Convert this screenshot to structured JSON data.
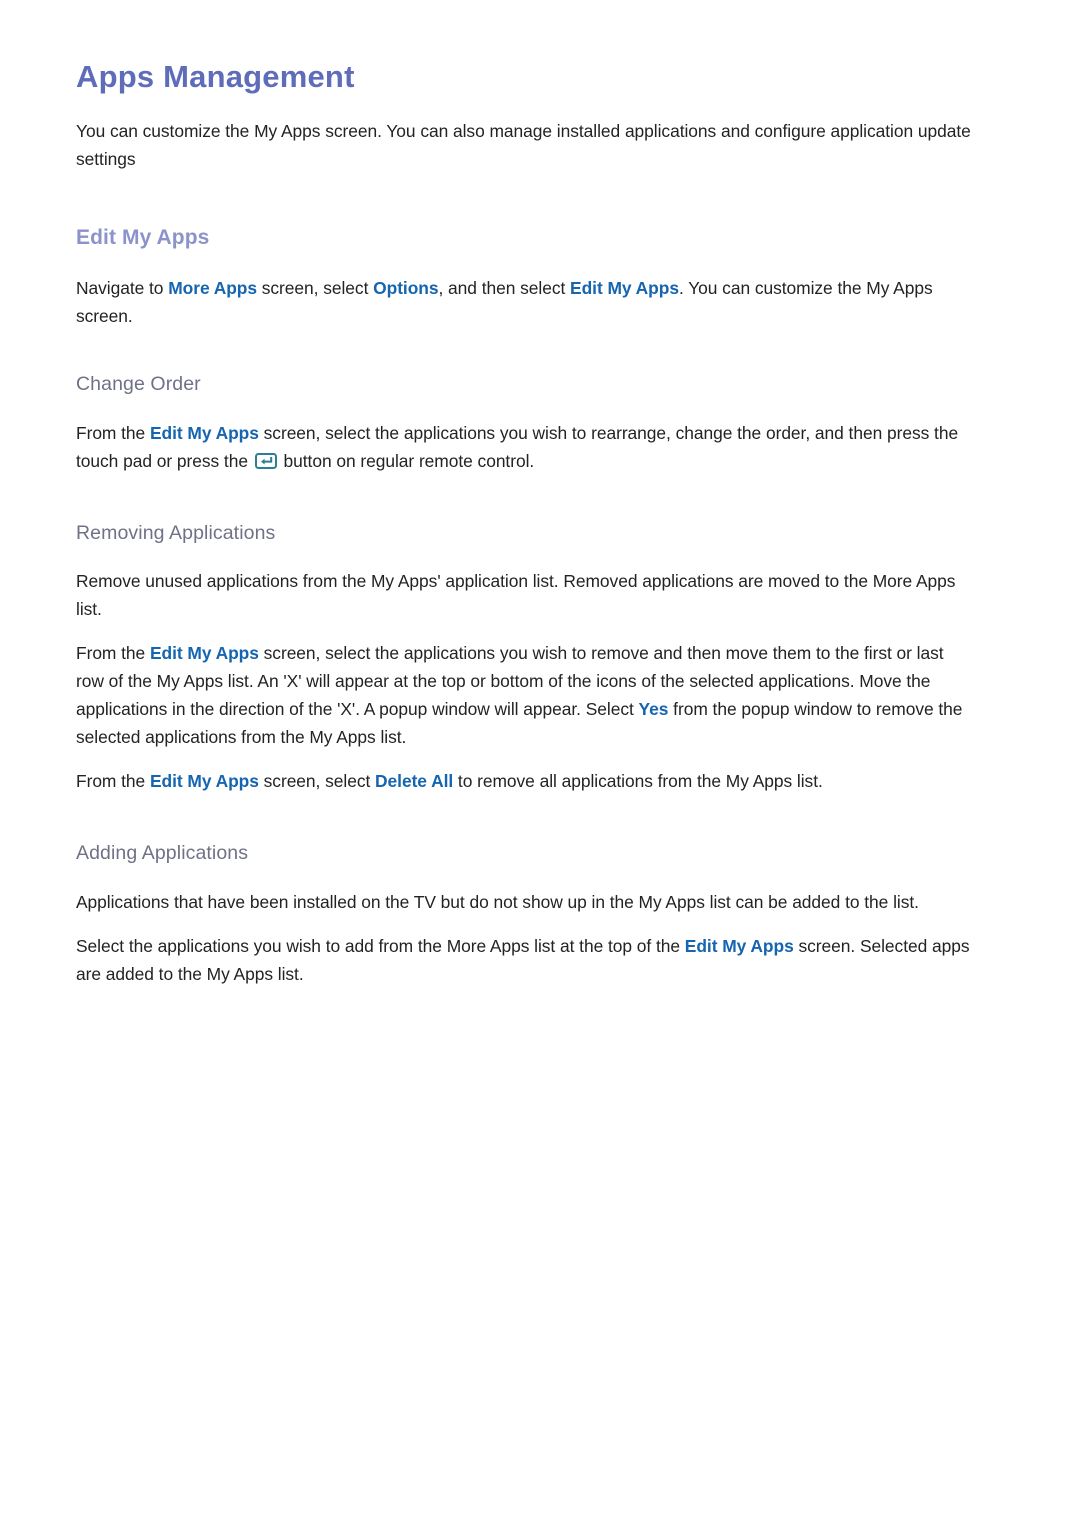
{
  "document": {
    "title": "Apps Management",
    "intro": "You can customize the My Apps screen. You can also manage installed applications and configure application update settings"
  },
  "colors": {
    "title": "#5f6cba",
    "section_heading": "#8b93ca",
    "subsection_heading": "#6f7287",
    "keyword_link": "#1565b0",
    "body_text": "#232323",
    "enter_icon": "#2d7d93",
    "page_background": "#ffffff"
  },
  "sections": [
    {
      "heading": "Edit My Apps",
      "paragraphs": [
        {
          "parts": [
            {
              "type": "text",
              "value": "Navigate to "
            },
            {
              "type": "keyword",
              "value": "More Apps"
            },
            {
              "type": "text",
              "value": " screen, select "
            },
            {
              "type": "keyword",
              "value": "Options"
            },
            {
              "type": "text",
              "value": ", and then select "
            },
            {
              "type": "keyword",
              "value": "Edit My Apps"
            },
            {
              "type": "text",
              "value": ". You can customize the My Apps screen."
            }
          ]
        }
      ],
      "subsections": [
        {
          "heading": "Change Order",
          "paragraphs": [
            {
              "parts": [
                {
                  "type": "text",
                  "value": "From the "
                },
                {
                  "type": "keyword",
                  "value": "Edit My Apps"
                },
                {
                  "type": "text",
                  "value": " screen, select the applications you wish to rearrange, change the order, and then press the touch pad or press the "
                },
                {
                  "type": "icon",
                  "value": "enter-key-icon"
                },
                {
                  "type": "text",
                  "value": " button on regular remote control."
                }
              ]
            }
          ]
        },
        {
          "heading": "Removing Applications",
          "paragraphs": [
            {
              "parts": [
                {
                  "type": "text",
                  "value": "Remove unused applications from the My Apps' application list. Removed applications are moved to the More Apps list."
                }
              ]
            },
            {
              "parts": [
                {
                  "type": "text",
                  "value": "From the "
                },
                {
                  "type": "keyword",
                  "value": "Edit My Apps"
                },
                {
                  "type": "text",
                  "value": " screen, select the applications you wish to remove and then move them to the first or last row of the My Apps list. An 'X' will appear at the top or bottom of the icons of the selected applications. Move the applications in the direction of the 'X'. A popup window will appear. Select "
                },
                {
                  "type": "keyword",
                  "value": "Yes"
                },
                {
                  "type": "text",
                  "value": " from the popup window to remove the selected applications from the My Apps list."
                }
              ]
            },
            {
              "parts": [
                {
                  "type": "text",
                  "value": "From the "
                },
                {
                  "type": "keyword",
                  "value": "Edit My Apps"
                },
                {
                  "type": "text",
                  "value": " screen, select "
                },
                {
                  "type": "keyword",
                  "value": "Delete All"
                },
                {
                  "type": "text",
                  "value": " to remove all applications from the My Apps list."
                }
              ]
            }
          ]
        },
        {
          "heading": "Adding Applications",
          "paragraphs": [
            {
              "parts": [
                {
                  "type": "text",
                  "value": "Applications that have been installed on the TV but do not show up in the My Apps list can be added to the list."
                }
              ]
            },
            {
              "parts": [
                {
                  "type": "text",
                  "value": "Select the applications you wish to add from the More Apps list at the top of the "
                },
                {
                  "type": "keyword",
                  "value": "Edit My Apps"
                },
                {
                  "type": "text",
                  "value": " screen. Selected apps are added to the My Apps list."
                }
              ]
            }
          ]
        }
      ]
    }
  ]
}
